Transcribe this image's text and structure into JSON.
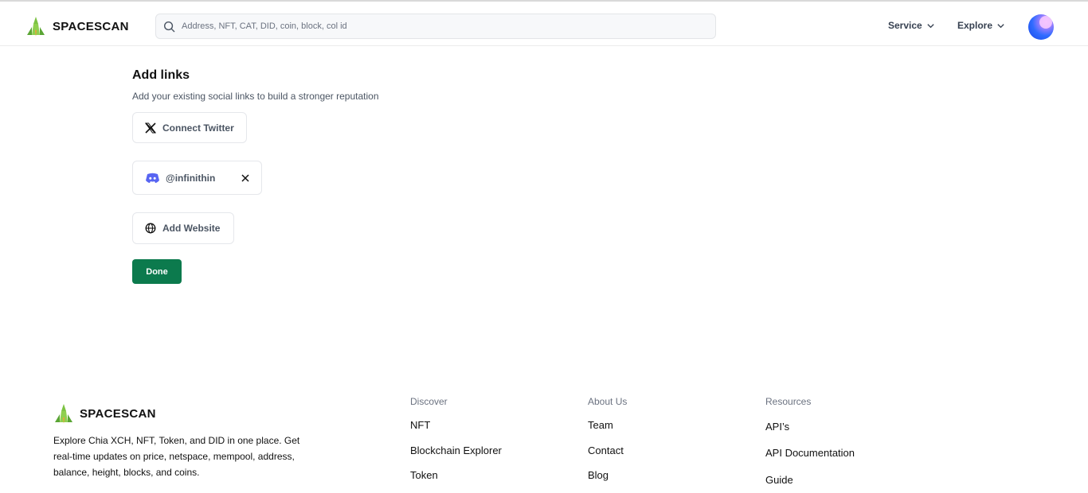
{
  "header": {
    "brand": "SPACESCAN",
    "search_placeholder": "Address, NFT, CAT, DID, coin, block, col id",
    "nav": [
      {
        "label": "Service"
      },
      {
        "label": "Explore"
      }
    ]
  },
  "main": {
    "title": "Add links",
    "subtitle": "Add your existing social links to build a stronger reputation",
    "twitter_label": "Connect Twitter",
    "discord_handle": "@infinithin",
    "website_label": "Add Website",
    "done_label": "Done"
  },
  "footer": {
    "brand": "SPACESCAN",
    "description": "Explore Chia XCH, NFT, Token, and DID in one place. Get real-time updates on price, netspace, mempool, address, balance, height, blocks, and coins.",
    "columns": [
      {
        "heading": "Discover",
        "links": [
          "NFT",
          "Blockchain Explorer",
          "Token"
        ]
      },
      {
        "heading": "About Us",
        "links": [
          "Team",
          "Contact",
          "Blog"
        ]
      },
      {
        "heading": "Resources",
        "links": [
          "API’s",
          "API Documentation",
          "Guide"
        ]
      }
    ]
  },
  "colors": {
    "accent_green": "#0c7a4d",
    "discord_blurple": "#5865f2"
  },
  "icons": [
    "spacescan-logo-icon",
    "search-icon",
    "chevron-down-icon",
    "x-twitter-icon",
    "discord-icon",
    "close-icon",
    "globe-icon"
  ]
}
